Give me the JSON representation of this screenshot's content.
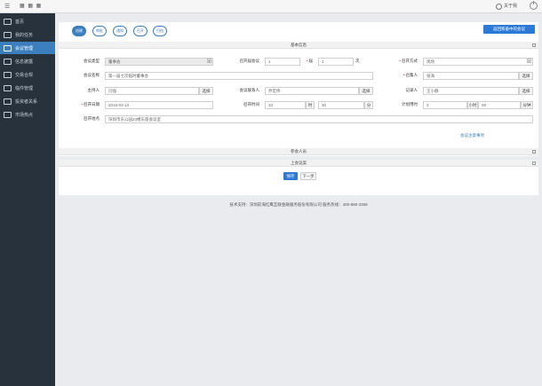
{
  "topbar": {
    "menu_icon": "☰",
    "apps_icon": "▦ ▦ ▦",
    "about_label": "关于我",
    "colors": {
      "background": "#f6f6f6"
    }
  },
  "sidebar": {
    "items": [
      {
        "label": "首页",
        "icon": "home-icon",
        "active": false
      },
      {
        "label": "我的任务",
        "icon": "task-icon",
        "active": false
      },
      {
        "label": "会议管理",
        "icon": "meeting-icon",
        "active": true
      },
      {
        "label": "信息披露",
        "icon": "disclosure-icon",
        "active": false
      },
      {
        "label": "交易合规",
        "icon": "compliance-icon",
        "active": false
      },
      {
        "label": "临件管理",
        "icon": "document-icon",
        "active": false
      },
      {
        "label": "投资者关系",
        "icon": "investor-icon",
        "active": false
      },
      {
        "label": "市场热点",
        "icon": "market-icon",
        "active": false
      }
    ],
    "colors": {
      "background": "#27323c",
      "active": "#3b7fbf"
    }
  },
  "steps": [
    {
      "label": "创建",
      "active": true
    },
    {
      "label": "审批",
      "active": false
    },
    {
      "label": "通知",
      "active": false
    },
    {
      "label": "召开",
      "active": false
    },
    {
      "label": "归档",
      "active": false
    }
  ],
  "back_button": "返回筹备中的会议",
  "basic_info": {
    "title": "基本信息",
    "meeting_type": {
      "label": "会议类型",
      "value": "董事会"
    },
    "session_prefix": {
      "label": "召开届会议",
      "value": "1"
    },
    "session_no": {
      "label": "届",
      "value": "1",
      "suffix": "次"
    },
    "convene_mode": {
      "label": "召开方式",
      "value": "现场"
    },
    "meeting_name": {
      "label": "会议名称",
      "value": "第一届七次临时董事会"
    },
    "convener": {
      "label": "召集人",
      "value": "张海",
      "action": "选择"
    },
    "host": {
      "label": "主持人",
      "value": "闫强",
      "action": "选择"
    },
    "contact": {
      "label": "会议联系人",
      "value": "乔宏伟",
      "action": "选择"
    },
    "recorder": {
      "label": "记录人",
      "value": "王小静",
      "action": "选择"
    },
    "date": {
      "label": "召开日期",
      "value": "2015-03-13"
    },
    "time": {
      "label": "召开时间",
      "hour": "10",
      "hour_unit": "时",
      "minute": "30",
      "minute_unit": "分"
    },
    "duration": {
      "label": "计划用时",
      "hours": "3",
      "hours_unit": "小时",
      "minutes": "00",
      "minutes_unit": "分钟"
    },
    "location": {
      "label": "召开地点",
      "value": "深圳市东公园23楼东座会议室"
    },
    "notes_link": "会议注意事项"
  },
  "participants": {
    "title": "参会人员"
  },
  "agenda": {
    "title": "上会议案"
  },
  "actions": {
    "save": "保存",
    "next": "下一步"
  },
  "footer": {
    "text": "技术支持：深圳前海红鹰互联金融服务股份有限公司  服务热线：400-880-3308"
  }
}
